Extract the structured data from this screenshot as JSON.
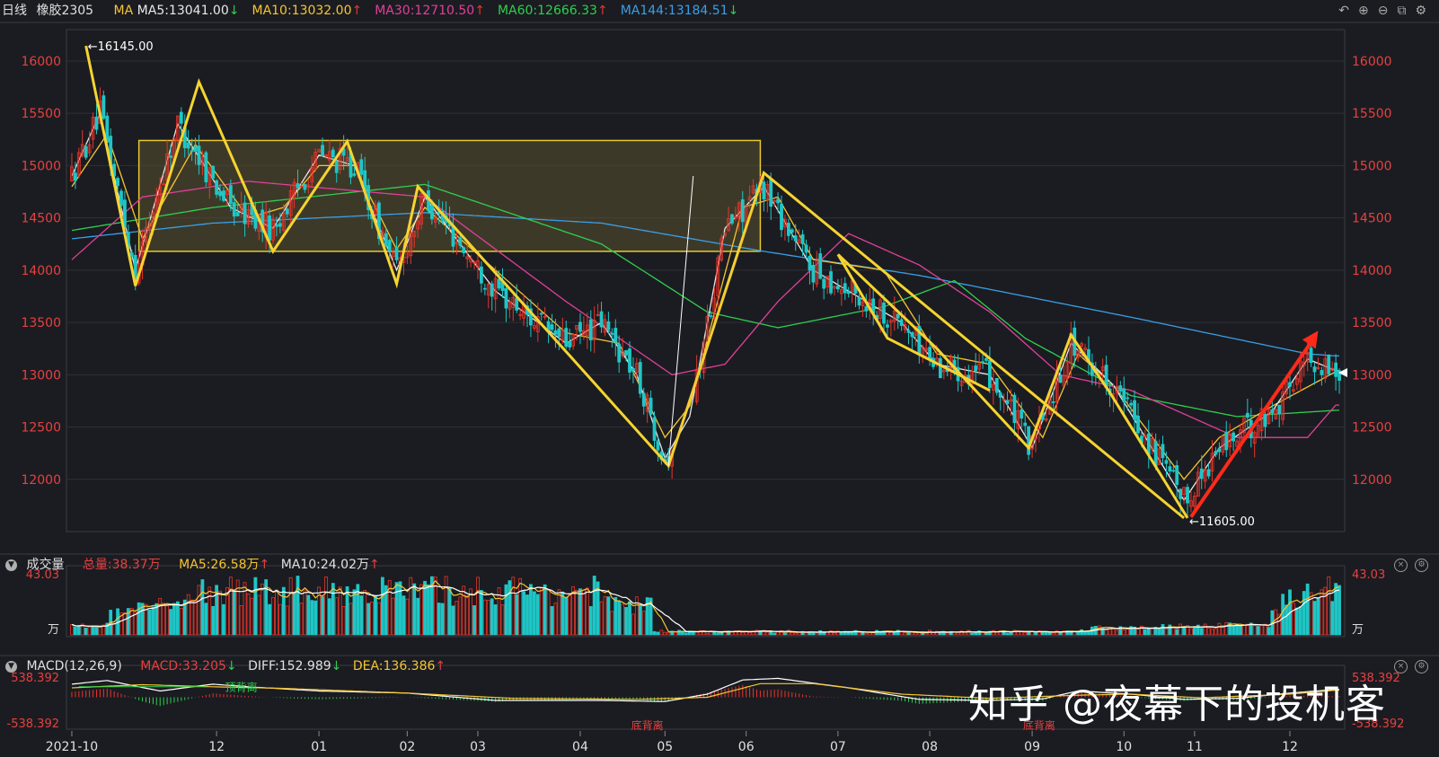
{
  "header": {
    "period": "日线",
    "symbol": "橡胶2305",
    "ma_label": "MA",
    "ma_items": [
      {
        "text": "MA5:13041.00",
        "arrow": "↓",
        "color": "#e8e8e8"
      },
      {
        "text": "MA10:13032.00",
        "arrow": "↑",
        "color": "#f5c532"
      },
      {
        "text": "MA30:12710.50",
        "arrow": "↑",
        "color": "#e0409a"
      },
      {
        "text": "MA60:12666.33",
        "arrow": "↑",
        "color": "#2fcf4f"
      },
      {
        "text": "MA144:13184.51",
        "arrow": "↓",
        "color": "#3a9fe8"
      }
    ]
  },
  "volume_header": {
    "name": "成交量",
    "total": "总量:38.37万",
    "ma5": "MA5:26.58万",
    "ma5_arrow": "↑",
    "ma10": "MA10:24.02万",
    "ma10_arrow": "↑"
  },
  "macd_header": {
    "name": "MACD(12,26,9)",
    "macd": "MACD:33.205",
    "macd_arrow": "↓",
    "diff": "DIFF:152.989",
    "diff_arrow": "↓",
    "dea": "DEA:136.386",
    "dea_arrow": "↑"
  },
  "watermark": "知乎 @夜幕下的投机客",
  "colors": {
    "up": "#e8352b",
    "down": "#1fc6c6",
    "ma5": "#e8e8e8",
    "ma10": "#f5c532",
    "ma30": "#e0409a",
    "ma60": "#2fcf4f",
    "ma144": "#3a9fe8",
    "zigzag": "#f5d430",
    "box_fill": "#5a5230",
    "box_stroke": "#e8c830",
    "axis_text": "#e84040",
    "grid": "#2e3038"
  },
  "chart_data": [
    {
      "type": "candlestick",
      "ylim": [
        11500,
        16300
      ],
      "y_ticks": [
        12000,
        12500,
        13000,
        13500,
        14000,
        14500,
        15000,
        15500,
        16000
      ],
      "x_tick_labels": [
        "2021-10",
        "12",
        "01",
        "02",
        "03",
        "04",
        "05",
        "06",
        "07",
        "08",
        "09",
        "10",
        "11",
        "12"
      ],
      "x_tick_positions": [
        0,
        41,
        70,
        95,
        115,
        144,
        168,
        191,
        217,
        243,
        272,
        298,
        318,
        345
      ],
      "n_bars": 360,
      "annotations": [
        {
          "text": "←16145.00",
          "bar": 4,
          "value": 16145
        },
        {
          "text": "←11605.00",
          "bar": 316,
          "value": 11605
        }
      ],
      "zigzag_points": [
        [
          4,
          16145
        ],
        [
          18,
          13850
        ],
        [
          36,
          15800
        ],
        [
          57,
          14180
        ],
        [
          78,
          15230
        ],
        [
          92,
          13870
        ],
        [
          98,
          14800
        ],
        [
          169,
          12130
        ],
        [
          196,
          14930
        ],
        [
          315,
          11630
        ]
      ],
      "zigzag_segments": [
        [
          [
            217,
            14150
          ],
          [
            245,
            13250
          ],
          [
            271,
            12300
          ],
          [
            283,
            13380
          ],
          [
            294,
            12830
          ],
          [
            316,
            11630
          ]
        ],
        [
          [
            217,
            14150
          ],
          [
            231,
            13350
          ],
          [
            260,
            12850
          ]
        ]
      ],
      "consolidation_box": {
        "bar_start": 19,
        "bar_end": 195,
        "top": 15240,
        "bottom": 14180
      },
      "trend_arrow": {
        "from": [
          317,
          11640
        ],
        "to": [
          353,
          13420
        ]
      },
      "ma_series": [
        {
          "name": "MA144",
          "anchors": [
            [
              0,
              14300
            ],
            [
              40,
              14450
            ],
            [
              100,
              14550
            ],
            [
              150,
              14450
            ],
            [
              196,
              14180
            ],
            [
              240,
              13950
            ],
            [
              300,
              13550
            ],
            [
              350,
              13200
            ],
            [
              358,
              13180
            ]
          ]
        },
        {
          "name": "MA60",
          "anchors": [
            [
              0,
              14380
            ],
            [
              40,
              14600
            ],
            [
              100,
              14820
            ],
            [
              150,
              14250
            ],
            [
              180,
              13600
            ],
            [
              200,
              13450
            ],
            [
              230,
              13650
            ],
            [
              250,
              13900
            ],
            [
              270,
              13350
            ],
            [
              300,
              12800
            ],
            [
              330,
              12600
            ],
            [
              358,
              12660
            ]
          ]
        },
        {
          "name": "MA30",
          "anchors": [
            [
              0,
              14100
            ],
            [
              20,
              14700
            ],
            [
              50,
              14850
            ],
            [
              100,
              14700
            ],
            [
              140,
              13700
            ],
            [
              170,
              13000
            ],
            [
              185,
              13100
            ],
            [
              200,
              13700
            ],
            [
              220,
              14350
            ],
            [
              240,
              14050
            ],
            [
              260,
              13600
            ],
            [
              280,
              13000
            ],
            [
              300,
              12850
            ],
            [
              330,
              12400
            ],
            [
              350,
              12400
            ],
            [
              358,
              12710
            ]
          ]
        },
        {
          "name": "MA10",
          "anchors": [
            [
              0,
              14800
            ],
            [
              10,
              15300
            ],
            [
              20,
              14300
            ],
            [
              35,
              15200
            ],
            [
              50,
              14500
            ],
            [
              60,
              14600
            ],
            [
              70,
              15000
            ],
            [
              80,
              15000
            ],
            [
              92,
              14200
            ],
            [
              100,
              14600
            ],
            [
              120,
              14000
            ],
            [
              140,
              13400
            ],
            [
              155,
              13300
            ],
            [
              168,
              12400
            ],
            [
              175,
              12700
            ],
            [
              190,
              14600
            ],
            [
              200,
              14700
            ],
            [
              210,
              14100
            ],
            [
              230,
              14000
            ],
            [
              245,
              13200
            ],
            [
              260,
              13100
            ],
            [
              275,
              12400
            ],
            [
              285,
              13200
            ],
            [
              295,
              12900
            ],
            [
              315,
              12000
            ],
            [
              325,
              12400
            ],
            [
              340,
              12700
            ],
            [
              358,
              13030
            ]
          ]
        },
        {
          "name": "MA5",
          "anchors": [
            [
              0,
              14900
            ],
            [
              8,
              15500
            ],
            [
              18,
              14000
            ],
            [
              30,
              15400
            ],
            [
              45,
              14600
            ],
            [
              57,
              14400
            ],
            [
              70,
              15100
            ],
            [
              80,
              15000
            ],
            [
              92,
              14000
            ],
            [
              100,
              14700
            ],
            [
              120,
              13800
            ],
            [
              140,
              13300
            ],
            [
              150,
              13500
            ],
            [
              160,
              13000
            ],
            [
              168,
              12200
            ],
            [
              175,
              12600
            ],
            [
              185,
              14400
            ],
            [
              196,
              14800
            ],
            [
              210,
              14000
            ],
            [
              235,
              13500
            ],
            [
              245,
              13100
            ],
            [
              260,
              13000
            ],
            [
              272,
              12300
            ],
            [
              283,
              13300
            ],
            [
              295,
              12900
            ],
            [
              315,
              11800
            ],
            [
              325,
              12300
            ],
            [
              340,
              12650
            ],
            [
              350,
              13150
            ],
            [
              358,
              13040
            ]
          ]
        }
      ]
    },
    {
      "type": "bar",
      "name": "成交量",
      "unit": "万",
      "ylim": [
        0,
        43.03
      ],
      "y_ticks_labels": [
        "43.03",
        "万"
      ]
    },
    {
      "type": "histogram+line",
      "name": "MACD(12,26,9)",
      "ylim": [
        -538.392,
        538.392
      ],
      "y_ticks_labels": [
        "538.392",
        "-538.392"
      ],
      "annotations": [
        {
          "text": "底背离",
          "bar": 163,
          "color": "#e84040"
        },
        {
          "text": "底背离",
          "bar": 274,
          "color": "#e84040"
        },
        {
          "text": "顶背离",
          "bar": 48,
          "color": "#2fcf4f"
        }
      ]
    }
  ]
}
